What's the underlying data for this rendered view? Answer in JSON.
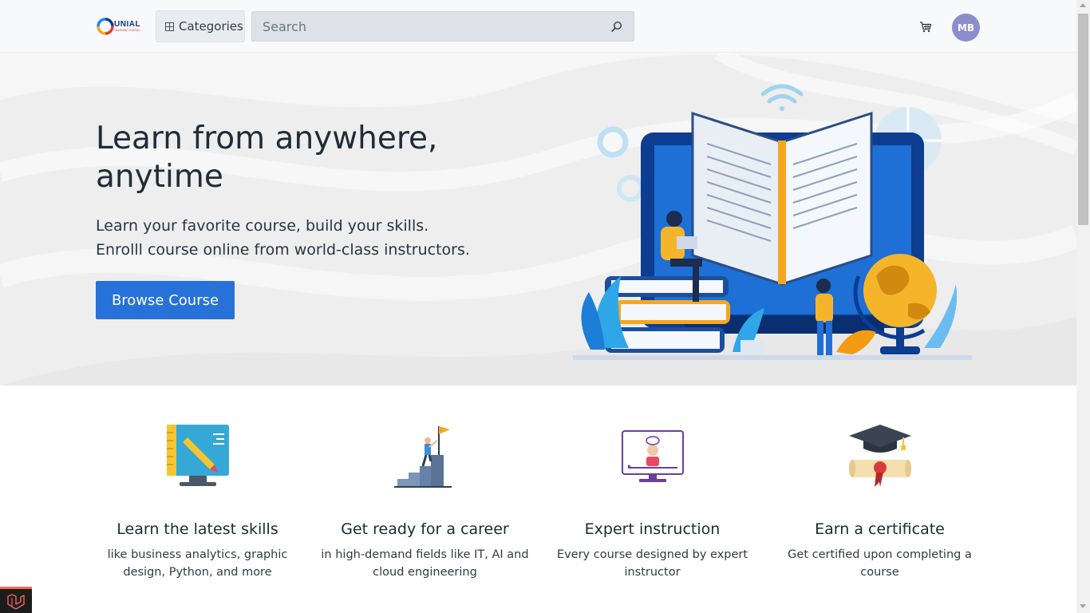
{
  "header": {
    "logo_text": "UNIAL",
    "logo_subtext": "LEARNING PORTAL",
    "categories_label": "Categories",
    "search_placeholder": "Search",
    "avatar_initials": "MB"
  },
  "hero": {
    "title": "Learn from anywhere, anytime",
    "subtitle_line1": "Learn your favorite course, build your skills.",
    "subtitle_line2": "Enrolll course online from world-class instructors.",
    "cta_label": "Browse Course"
  },
  "features": [
    {
      "title": "Learn the latest skills",
      "text": "like business analytics, graphic design, Python, and more",
      "icon": "design-monitor-icon"
    },
    {
      "title": "Get ready for a career",
      "text": "in high-demand fields like IT, AI and cloud engineering",
      "icon": "career-flag-icon"
    },
    {
      "title": "Expert instruction",
      "text": "Every course designed by expert instructor",
      "icon": "instructor-video-icon"
    },
    {
      "title": "Earn a certificate",
      "text": "Get certified upon completing a course",
      "icon": "graduation-cap-icon"
    }
  ],
  "colors": {
    "primary": "#2672d8",
    "avatar": "#8c8ccf",
    "hero_background": "#eeeeee",
    "header_background": "#f8f9fa"
  }
}
